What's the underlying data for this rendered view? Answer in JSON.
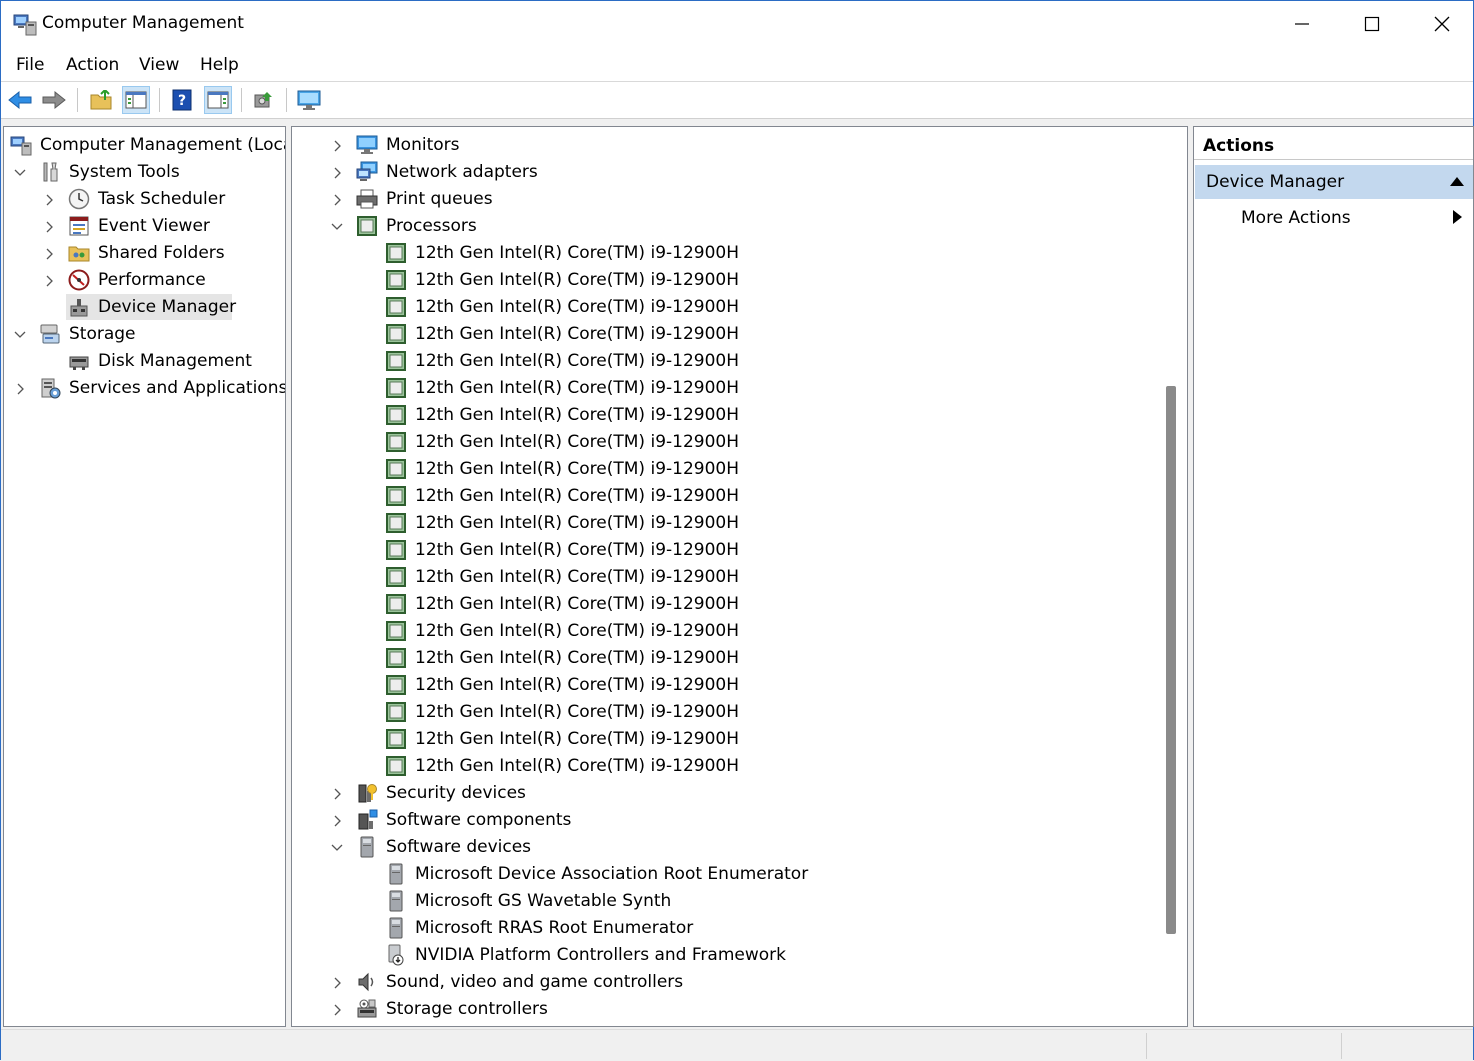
{
  "window": {
    "title": "Computer Management",
    "app_icon": "computer-management-icon",
    "minimize_icon": "minimize-icon",
    "maximize_icon": "maximize-icon",
    "close_icon": "close-icon"
  },
  "menu": [
    "File",
    "Action",
    "View",
    "Help"
  ],
  "toolbar": [
    {
      "name": "back-button",
      "icon": "back-arrow-icon"
    },
    {
      "name": "forward-button",
      "icon": "forward-arrow-icon"
    },
    {
      "name": "up-one-level-button",
      "icon": "folder-up-icon"
    },
    {
      "name": "show-hide-console-tree-button",
      "icon": "console-tree-icon",
      "pressed": true
    },
    {
      "name": "help-button",
      "icon": "help-icon"
    },
    {
      "name": "show-hide-action-pane-button",
      "icon": "action-pane-icon",
      "pressed": true
    },
    {
      "name": "scan-hardware-button",
      "icon": "scan-hardware-icon"
    },
    {
      "name": "display-button",
      "icon": "monitor-icon"
    }
  ],
  "left_tree": [
    {
      "label": "Computer Management (Local)",
      "level": 0,
      "chevron": "none",
      "icon": "computer-management-icon"
    },
    {
      "label": "System Tools",
      "level": 1,
      "chevron": "down",
      "icon": "system-tools-icon"
    },
    {
      "label": "Task Scheduler",
      "level": 2,
      "chevron": "right",
      "icon": "clock-icon"
    },
    {
      "label": "Event Viewer",
      "level": 2,
      "chevron": "right",
      "icon": "event-viewer-icon"
    },
    {
      "label": "Shared Folders",
      "level": 2,
      "chevron": "right",
      "icon": "shared-folders-icon"
    },
    {
      "label": "Performance",
      "level": 2,
      "chevron": "right",
      "icon": "performance-icon"
    },
    {
      "label": "Device Manager",
      "level": 2,
      "chevron": "none",
      "icon": "device-manager-icon",
      "selected": true
    },
    {
      "label": "Storage",
      "level": 1,
      "chevron": "down",
      "icon": "storage-icon"
    },
    {
      "label": "Disk Management",
      "level": 2,
      "chevron": "none",
      "icon": "disk-management-icon"
    },
    {
      "label": "Services and Applications",
      "level": 1,
      "chevron": "right",
      "icon": "services-icon"
    }
  ],
  "device_tree": [
    {
      "label": "Monitors",
      "level": 0,
      "chevron": "right",
      "icon": "monitor-icon"
    },
    {
      "label": "Network adapters",
      "level": 0,
      "chevron": "right",
      "icon": "network-adapter-icon"
    },
    {
      "label": "Print queues",
      "level": 0,
      "chevron": "right",
      "icon": "printer-icon"
    },
    {
      "label": "Processors",
      "level": 0,
      "chevron": "down",
      "icon": "processor-icon"
    },
    {
      "label": "12th Gen Intel(R) Core(TM) i9-12900H",
      "level": 1,
      "chevron": "none",
      "icon": "processor-icon"
    },
    {
      "label": "12th Gen Intel(R) Core(TM) i9-12900H",
      "level": 1,
      "chevron": "none",
      "icon": "processor-icon"
    },
    {
      "label": "12th Gen Intel(R) Core(TM) i9-12900H",
      "level": 1,
      "chevron": "none",
      "icon": "processor-icon"
    },
    {
      "label": "12th Gen Intel(R) Core(TM) i9-12900H",
      "level": 1,
      "chevron": "none",
      "icon": "processor-icon"
    },
    {
      "label": "12th Gen Intel(R) Core(TM) i9-12900H",
      "level": 1,
      "chevron": "none",
      "icon": "processor-icon"
    },
    {
      "label": "12th Gen Intel(R) Core(TM) i9-12900H",
      "level": 1,
      "chevron": "none",
      "icon": "processor-icon"
    },
    {
      "label": "12th Gen Intel(R) Core(TM) i9-12900H",
      "level": 1,
      "chevron": "none",
      "icon": "processor-icon"
    },
    {
      "label": "12th Gen Intel(R) Core(TM) i9-12900H",
      "level": 1,
      "chevron": "none",
      "icon": "processor-icon"
    },
    {
      "label": "12th Gen Intel(R) Core(TM) i9-12900H",
      "level": 1,
      "chevron": "none",
      "icon": "processor-icon"
    },
    {
      "label": "12th Gen Intel(R) Core(TM) i9-12900H",
      "level": 1,
      "chevron": "none",
      "icon": "processor-icon"
    },
    {
      "label": "12th Gen Intel(R) Core(TM) i9-12900H",
      "level": 1,
      "chevron": "none",
      "icon": "processor-icon"
    },
    {
      "label": "12th Gen Intel(R) Core(TM) i9-12900H",
      "level": 1,
      "chevron": "none",
      "icon": "processor-icon"
    },
    {
      "label": "12th Gen Intel(R) Core(TM) i9-12900H",
      "level": 1,
      "chevron": "none",
      "icon": "processor-icon"
    },
    {
      "label": "12th Gen Intel(R) Core(TM) i9-12900H",
      "level": 1,
      "chevron": "none",
      "icon": "processor-icon"
    },
    {
      "label": "12th Gen Intel(R) Core(TM) i9-12900H",
      "level": 1,
      "chevron": "none",
      "icon": "processor-icon"
    },
    {
      "label": "12th Gen Intel(R) Core(TM) i9-12900H",
      "level": 1,
      "chevron": "none",
      "icon": "processor-icon"
    },
    {
      "label": "12th Gen Intel(R) Core(TM) i9-12900H",
      "level": 1,
      "chevron": "none",
      "icon": "processor-icon"
    },
    {
      "label": "12th Gen Intel(R) Core(TM) i9-12900H",
      "level": 1,
      "chevron": "none",
      "icon": "processor-icon"
    },
    {
      "label": "12th Gen Intel(R) Core(TM) i9-12900H",
      "level": 1,
      "chevron": "none",
      "icon": "processor-icon"
    },
    {
      "label": "12th Gen Intel(R) Core(TM) i9-12900H",
      "level": 1,
      "chevron": "none",
      "icon": "processor-icon"
    },
    {
      "label": "Security devices",
      "level": 0,
      "chevron": "right",
      "icon": "security-device-icon"
    },
    {
      "label": "Software components",
      "level": 0,
      "chevron": "right",
      "icon": "software-component-icon"
    },
    {
      "label": "Software devices",
      "level": 0,
      "chevron": "down",
      "icon": "software-device-icon"
    },
    {
      "label": "Microsoft Device Association Root Enumerator",
      "level": 1,
      "chevron": "none",
      "icon": "software-device-icon"
    },
    {
      "label": "Microsoft GS Wavetable Synth",
      "level": 1,
      "chevron": "none",
      "icon": "software-device-icon"
    },
    {
      "label": "Microsoft RRAS Root Enumerator",
      "level": 1,
      "chevron": "none",
      "icon": "software-device-icon"
    },
    {
      "label": "NVIDIA Platform Controllers and Framework",
      "level": 1,
      "chevron": "none",
      "icon": "disabled-device-icon"
    },
    {
      "label": "Sound, video and game controllers",
      "level": 0,
      "chevron": "right",
      "icon": "speaker-icon"
    },
    {
      "label": "Storage controllers",
      "level": 0,
      "chevron": "right",
      "icon": "storage-controller-icon"
    }
  ],
  "actions": {
    "title": "Actions",
    "section": "Device Manager",
    "section_icon": "collapse-up-icon",
    "more": "More Actions",
    "more_icon": "submenu-arrow-icon"
  }
}
